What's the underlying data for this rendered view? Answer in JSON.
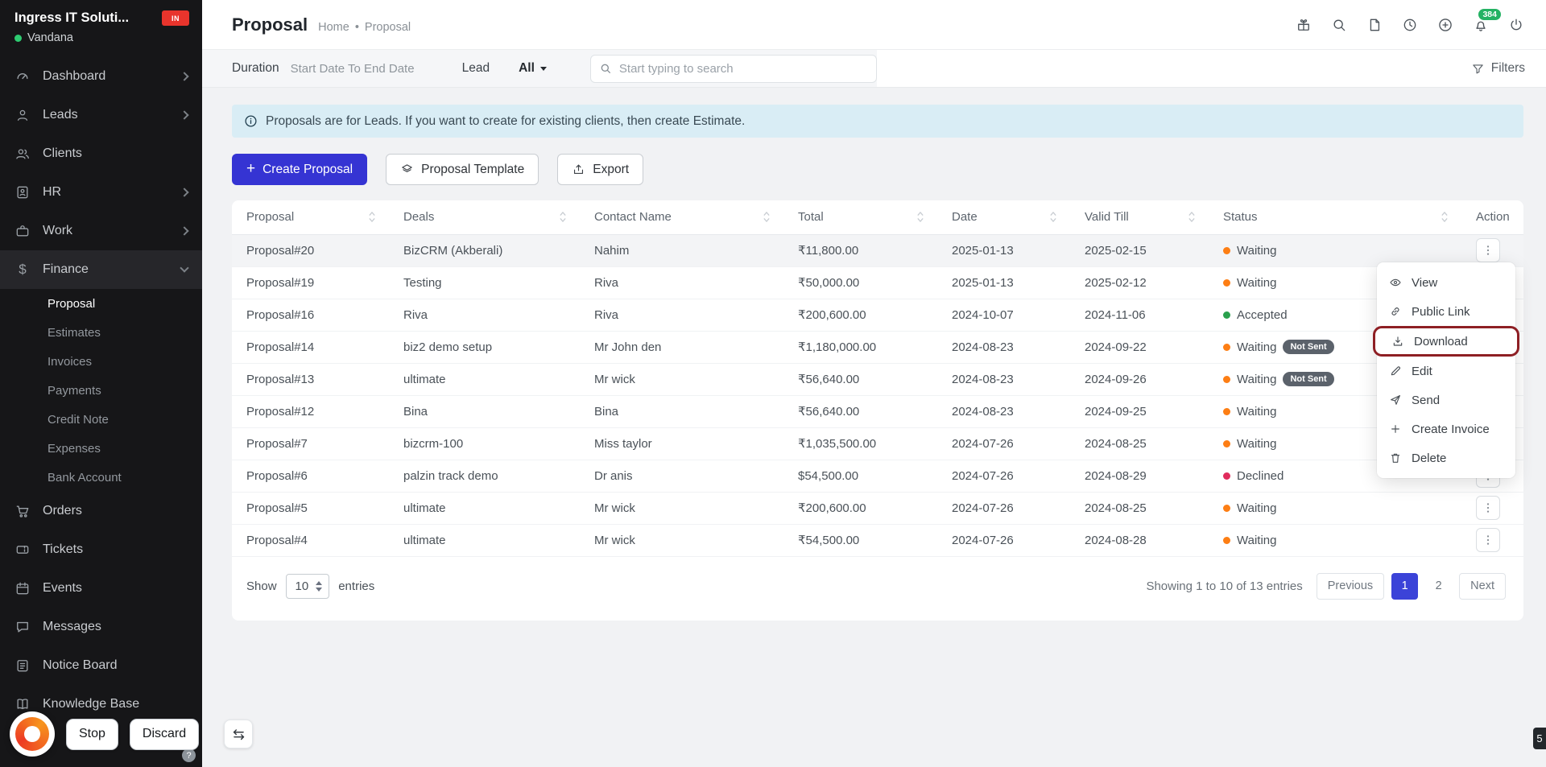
{
  "theme": {
    "accent": "#3534d3",
    "sidebar_bg": "#161618",
    "alert_bg": "#d9edf5",
    "status_colors": {
      "waiting": "#fd7e14",
      "accepted": "#2aa14d",
      "declined": "#e02c5c"
    },
    "annotation_color": "#8e1f24",
    "notification_badge_color": "#24b263"
  },
  "sidebar": {
    "company": "Ingress IT Soluti...",
    "user": "Vandana",
    "logo_text": "IN",
    "items": [
      {
        "label": "Dashboard",
        "icon": "dashboard-icon",
        "chevron": true
      },
      {
        "label": "Leads",
        "icon": "leads-icon",
        "chevron": true
      },
      {
        "label": "Clients",
        "icon": "clients-icon",
        "chevron": false
      },
      {
        "label": "HR",
        "icon": "hr-icon",
        "chevron": true
      },
      {
        "label": "Work",
        "icon": "work-icon",
        "chevron": true
      },
      {
        "label": "Finance",
        "icon": "finance-icon",
        "chevron": true,
        "expanded": true
      },
      {
        "label": "Orders",
        "icon": "orders-icon",
        "chevron": false
      },
      {
        "label": "Tickets",
        "icon": "tickets-icon",
        "chevron": false
      },
      {
        "label": "Events",
        "icon": "events-icon",
        "chevron": false
      },
      {
        "label": "Messages",
        "icon": "messages-icon",
        "chevron": false
      },
      {
        "label": "Notice Board",
        "icon": "notice-board-icon",
        "chevron": false
      },
      {
        "label": "Knowledge Base",
        "icon": "knowledge-base-icon",
        "chevron": false
      }
    ],
    "finance_subitems": [
      "Proposal",
      "Estimates",
      "Invoices",
      "Payments",
      "Credit Note",
      "Expenses",
      "Bank Account"
    ],
    "active_subitem": "Proposal"
  },
  "header": {
    "title": "Proposal",
    "breadcrumb_home": "Home",
    "breadcrumb_sep": "•",
    "breadcrumb_current": "Proposal",
    "icons": [
      "gift-icon",
      "search-icon",
      "notes-icon",
      "history-icon",
      "add-icon",
      "notifications-icon",
      "power-icon"
    ],
    "notification_count": "384"
  },
  "filterbar": {
    "duration_label": "Duration",
    "duration_placeholder": "Start Date To End Date",
    "lead_label": "Lead",
    "lead_value": "All",
    "search_placeholder": "Start typing to search",
    "filters_button": "Filters"
  },
  "alert": {
    "text": "Proposals are for Leads. If you want to create for existing clients, then create Estimate."
  },
  "actions": {
    "create": "Create Proposal",
    "template": "Proposal Template",
    "export": "Export"
  },
  "table": {
    "columns": [
      "Proposal",
      "Deals",
      "Contact Name",
      "Total",
      "Date",
      "Valid Till",
      "Status",
      "Action"
    ],
    "rows": [
      {
        "proposal": "Proposal#20",
        "deals": "BizCRM (Akberali)",
        "contact": "Nahim",
        "total": "₹11,800.00",
        "date": "2025-01-13",
        "valid_till": "2025-02-15",
        "status": "Waiting",
        "status_key": "waiting"
      },
      {
        "proposal": "Proposal#19",
        "deals": "Testing",
        "contact": "Riva",
        "total": "₹50,000.00",
        "date": "2025-01-13",
        "valid_till": "2025-02-12",
        "status": "Waiting",
        "status_key": "waiting"
      },
      {
        "proposal": "Proposal#16",
        "deals": "Riva",
        "contact": "Riva",
        "total": "₹200,600.00",
        "date": "2024-10-07",
        "valid_till": "2024-11-06",
        "status": "Accepted",
        "status_key": "accepted"
      },
      {
        "proposal": "Proposal#14",
        "deals": "biz2 demo setup",
        "contact": "Mr John den",
        "total": "₹1,180,000.00",
        "date": "2024-08-23",
        "valid_till": "2024-09-22",
        "status": "Waiting",
        "status_key": "waiting",
        "badge": "Not Sent"
      },
      {
        "proposal": "Proposal#13",
        "deals": "ultimate",
        "contact": "Mr wick",
        "total": "₹56,640.00",
        "date": "2024-08-23",
        "valid_till": "2024-09-26",
        "status": "Waiting",
        "status_key": "waiting",
        "badge": "Not Sent"
      },
      {
        "proposal": "Proposal#12",
        "deals": "Bina",
        "contact": "Bina",
        "total": "₹56,640.00",
        "date": "2024-08-23",
        "valid_till": "2024-09-25",
        "status": "Waiting",
        "status_key": "waiting"
      },
      {
        "proposal": "Proposal#7",
        "deals": "bizcrm-100",
        "contact": "Miss taylor",
        "total": "₹1,035,500.00",
        "date": "2024-07-26",
        "valid_till": "2024-08-25",
        "status": "Waiting",
        "status_key": "waiting"
      },
      {
        "proposal": "Proposal#6",
        "deals": "palzin track demo",
        "contact": "Dr anis",
        "total": "$54,500.00",
        "date": "2024-07-26",
        "valid_till": "2024-08-29",
        "status": "Declined",
        "status_key": "declined"
      },
      {
        "proposal": "Proposal#5",
        "deals": "ultimate",
        "contact": "Mr wick",
        "total": "₹200,600.00",
        "date": "2024-07-26",
        "valid_till": "2024-08-25",
        "status": "Waiting",
        "status_key": "waiting"
      },
      {
        "proposal": "Proposal#4",
        "deals": "ultimate",
        "contact": "Mr wick",
        "total": "₹54,500.00",
        "date": "2024-07-26",
        "valid_till": "2024-08-28",
        "status": "Waiting",
        "status_key": "waiting"
      }
    ],
    "footer": {
      "show_label": "Show",
      "show_value": "10",
      "entries_label": "entries",
      "summary": "Showing 1 to 10 of 13 entries",
      "previous": "Previous",
      "pages": [
        "1",
        "2"
      ],
      "active_page": "1",
      "next": "Next"
    }
  },
  "context_menu": {
    "items": [
      {
        "label": "View",
        "icon": "eye-icon"
      },
      {
        "label": "Public Link",
        "icon": "link-icon"
      },
      {
        "label": "Download",
        "icon": "download-icon",
        "highlighted": true
      },
      {
        "label": "Edit",
        "icon": "edit-icon"
      },
      {
        "label": "Send",
        "icon": "send-icon"
      },
      {
        "label": "Create Invoice",
        "icon": "plus-icon"
      },
      {
        "label": "Delete",
        "icon": "trash-icon"
      }
    ]
  },
  "bottom_bar": {
    "stop": "Stop",
    "discard": "Discard",
    "help": "?"
  },
  "page_badge": "5"
}
